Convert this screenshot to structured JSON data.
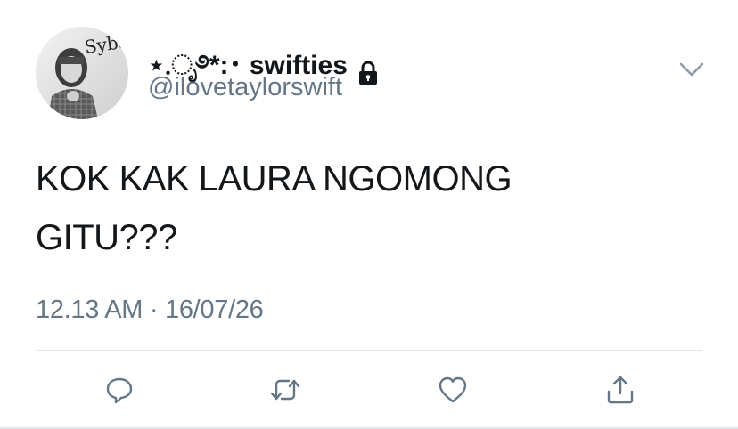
{
  "profile": {
    "display_name": "⋆.ೃ࿔*:･ swifties",
    "handle": "@ilovetaylorswift",
    "avatar_caption": "Sybau"
  },
  "tweet": {
    "line1": "KOK KAK LAURA NGOMONG",
    "line2": "GITU???",
    "timestamp": "12.13 AM · 16/07/26"
  },
  "icons": {
    "lock": "lock-icon",
    "more": "chevron-down-icon",
    "reply": "reply-icon",
    "retweet": "retweet-icon",
    "like": "heart-icon",
    "share": "share-icon"
  },
  "colors": {
    "text": "#14171a",
    "secondary": "#657786",
    "icon": "#657786",
    "divider": "#e1e8ed"
  }
}
